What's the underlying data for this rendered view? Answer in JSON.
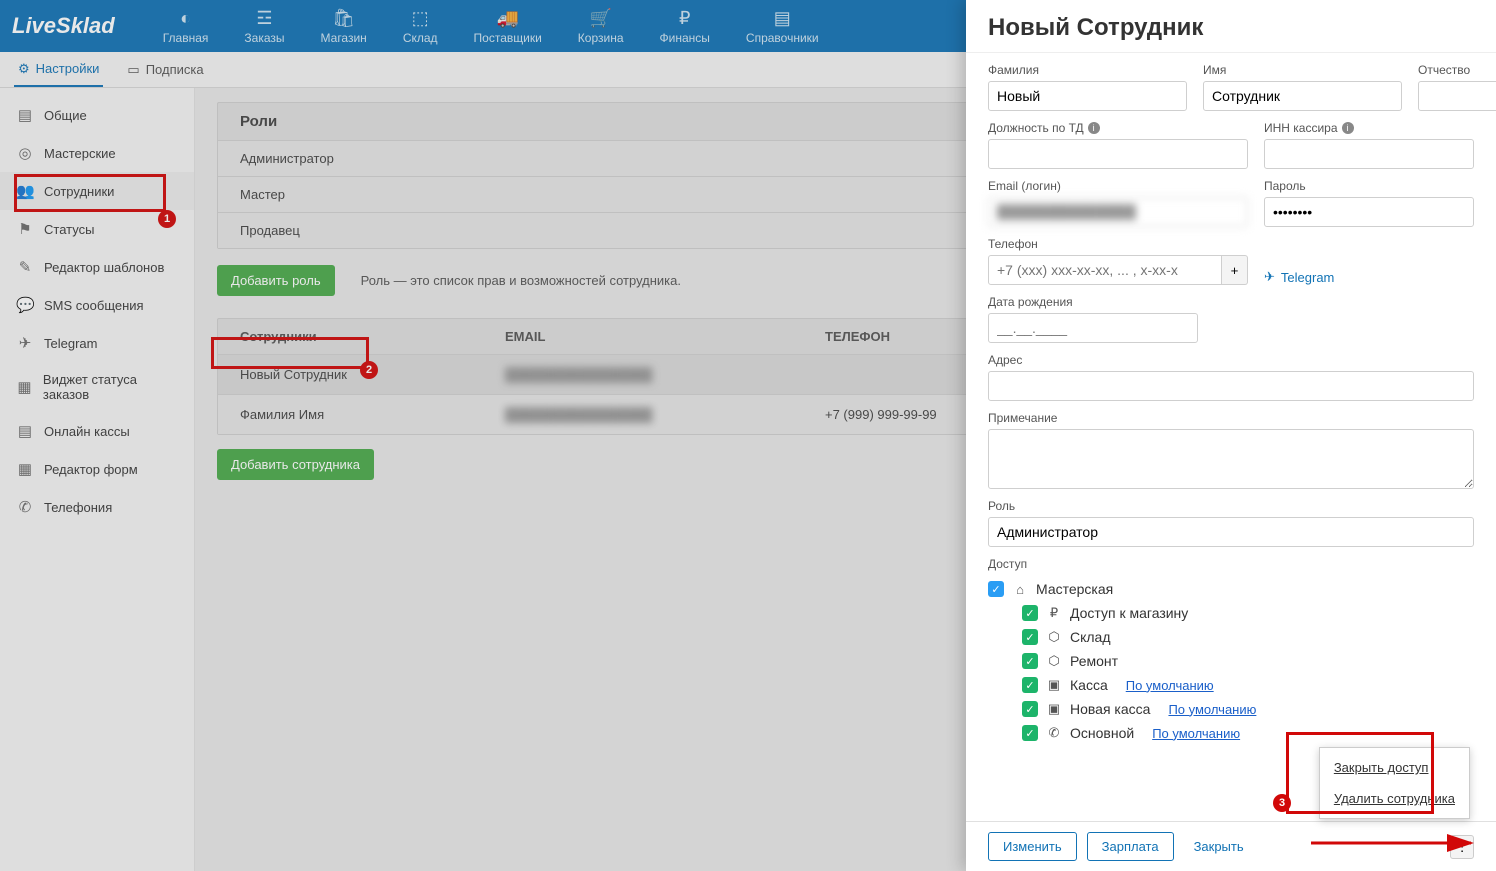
{
  "logo": "LiveSklad",
  "topnav": [
    {
      "label": "Главная"
    },
    {
      "label": "Заказы"
    },
    {
      "label": "Магазин"
    },
    {
      "label": "Склад"
    },
    {
      "label": "Поставщики"
    },
    {
      "label": "Корзина"
    },
    {
      "label": "Финансы"
    },
    {
      "label": "Справочники"
    }
  ],
  "subtabs": [
    {
      "label": "Настройки",
      "active": true
    },
    {
      "label": "Подписка",
      "active": false
    }
  ],
  "sidebar": [
    {
      "label": "Общие"
    },
    {
      "label": "Мастерские"
    },
    {
      "label": "Сотрудники"
    },
    {
      "label": "Статусы"
    },
    {
      "label": "Редактор шаблонов"
    },
    {
      "label": "SMS сообщения"
    },
    {
      "label": "Telegram"
    },
    {
      "label": "Виджет статуса заказов"
    },
    {
      "label": "Онлайн кассы"
    },
    {
      "label": "Редактор форм"
    },
    {
      "label": "Телефония"
    }
  ],
  "roles": {
    "title": "Роли",
    "items": [
      "Администратор",
      "Мастер",
      "Продавец"
    ],
    "add_btn": "Добавить роль",
    "hint": "Роль — это список прав и возможностей сотрудника."
  },
  "employees": {
    "title": "Сотрудники",
    "cols": {
      "email": "EMAIL",
      "phone": "ТЕЛЕФОН"
    },
    "rows": [
      {
        "name": "Новый Сотрудник",
        "email": "████████████████",
        "phone": ""
      },
      {
        "name": "Фамилия Имя",
        "email": "████████████████",
        "phone": "+7 (999) 999-99-99"
      }
    ],
    "add_btn": "Добавить сотрудника"
  },
  "drawer": {
    "title": "Новый Сотрудник",
    "labels": {
      "lastname": "Фамилия",
      "firstname": "Имя",
      "patronymic": "Отчество",
      "position": "Должность по ТД",
      "inn": "ИНН кассира",
      "email": "Email (логин)",
      "password": "Пароль",
      "phone": "Телефон",
      "telegram": "Telegram",
      "dob": "Дата рождения",
      "address": "Адрес",
      "note": "Примечание",
      "role": "Роль",
      "access": "Доступ"
    },
    "values": {
      "lastname": "Новый",
      "firstname": "Сотрудник",
      "patronymic": "",
      "position": "",
      "inn": "",
      "email_blurred": "██████████████",
      "password": "********",
      "phone_placeholder": "+7 (xxx) xxx-xx-xx, ... , x-xx-x",
      "dob_placeholder": "__.__.____",
      "role": "Администратор"
    },
    "access": {
      "root": "Мастерская",
      "items": [
        {
          "label": "Доступ к магазину",
          "icon": "₽",
          "default": false
        },
        {
          "label": "Склад",
          "icon": "⬡",
          "default": false
        },
        {
          "label": "Ремонт",
          "icon": "⬡",
          "default": false
        },
        {
          "label": "Касса",
          "icon": "▣",
          "default": true
        },
        {
          "label": "Новая касса",
          "icon": "▣",
          "default": true
        },
        {
          "label": "Основной",
          "icon": "✆",
          "default": true
        }
      ],
      "default_label": "По умолчанию"
    },
    "footer": {
      "edit": "Изменить",
      "salary": "Зарплата",
      "close": "Закрыть"
    },
    "menu": {
      "close_access": "Закрыть доступ",
      "delete": "Удалить сотрудника"
    }
  },
  "annotations": {
    "b1": "1",
    "b2": "2",
    "b3": "3"
  }
}
